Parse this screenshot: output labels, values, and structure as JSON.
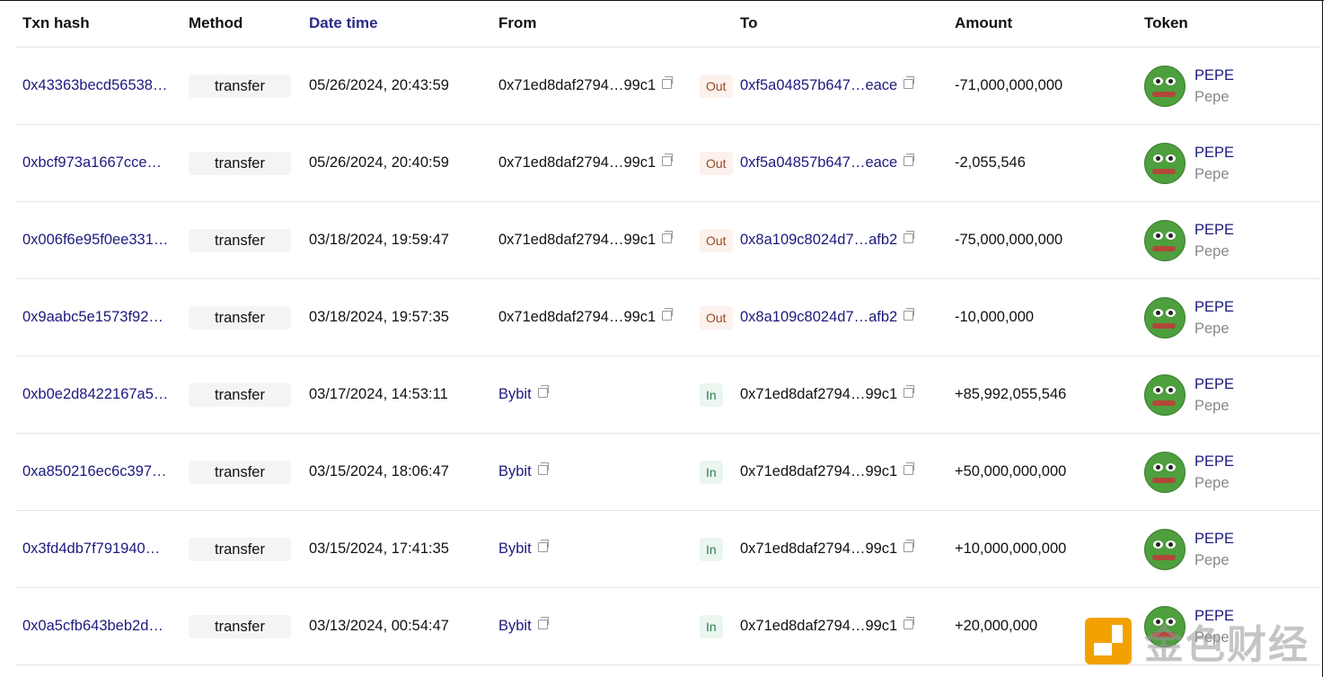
{
  "headers": {
    "txn_hash": "Txn hash",
    "method": "Method",
    "date_time": "Date time",
    "from": "From",
    "to": "To",
    "amount": "Amount",
    "token": "Token"
  },
  "rows": [
    {
      "hash": "0x43363becd56538…",
      "method": "transfer",
      "date": "05/26/2024, 20:43:59",
      "from": "0x71ed8daf2794…99c1",
      "from_link": false,
      "dir": "Out",
      "to": "0xf5a04857b647…eace",
      "to_link": true,
      "amount": "-71,000,000,000",
      "token_symbol": "PEPE",
      "token_name": "Pepe"
    },
    {
      "hash": "0xbcf973a1667cce…",
      "method": "transfer",
      "date": "05/26/2024, 20:40:59",
      "from": "0x71ed8daf2794…99c1",
      "from_link": false,
      "dir": "Out",
      "to": "0xf5a04857b647…eace",
      "to_link": true,
      "amount": "-2,055,546",
      "token_symbol": "PEPE",
      "token_name": "Pepe"
    },
    {
      "hash": "0x006f6e95f0ee331…",
      "method": "transfer",
      "date": "03/18/2024, 19:59:47",
      "from": "0x71ed8daf2794…99c1",
      "from_link": false,
      "dir": "Out",
      "to": "0x8a109c8024d7…afb2",
      "to_link": true,
      "amount": "-75,000,000,000",
      "token_symbol": "PEPE",
      "token_name": "Pepe"
    },
    {
      "hash": "0x9aabc5e1573f92…",
      "method": "transfer",
      "date": "03/18/2024, 19:57:35",
      "from": "0x71ed8daf2794…99c1",
      "from_link": false,
      "dir": "Out",
      "to": "0x8a109c8024d7…afb2",
      "to_link": true,
      "amount": "-10,000,000",
      "token_symbol": "PEPE",
      "token_name": "Pepe"
    },
    {
      "hash": "0xb0e2d8422167a5…",
      "method": "transfer",
      "date": "03/17/2024, 14:53:11",
      "from": "Bybit",
      "from_link": true,
      "dir": "In",
      "to": "0x71ed8daf2794…99c1",
      "to_link": false,
      "amount": "+85,992,055,546",
      "token_symbol": "PEPE",
      "token_name": "Pepe"
    },
    {
      "hash": "0xa850216ec6c397…",
      "method": "transfer",
      "date": "03/15/2024, 18:06:47",
      "from": "Bybit",
      "from_link": true,
      "dir": "In",
      "to": "0x71ed8daf2794…99c1",
      "to_link": false,
      "amount": "+50,000,000,000",
      "token_symbol": "PEPE",
      "token_name": "Pepe"
    },
    {
      "hash": "0x3fd4db7f791940…",
      "method": "transfer",
      "date": "03/15/2024, 17:41:35",
      "from": "Bybit",
      "from_link": true,
      "dir": "In",
      "to": "0x71ed8daf2794…99c1",
      "to_link": false,
      "amount": "+10,000,000,000",
      "token_symbol": "PEPE",
      "token_name": "Pepe"
    },
    {
      "hash": "0x0a5cfb643beb2d…",
      "method": "transfer",
      "date": "03/13/2024, 00:54:47",
      "from": "Bybit",
      "from_link": true,
      "dir": "In",
      "to": "0x71ed8daf2794…99c1",
      "to_link": false,
      "amount": "+20,000,000",
      "token_symbol": "PEPE",
      "token_name": "Pepe"
    }
  ],
  "watermark": {
    "text": "金色财经"
  },
  "colors": {
    "link": "#1c1a7e",
    "out_badge_bg": "#fcf1ec",
    "in_badge_bg": "#eaf6ef",
    "watermark_logo": "#f2a100"
  },
  "icons": {
    "copy": "copy-icon",
    "token": "pepe-token-icon"
  }
}
